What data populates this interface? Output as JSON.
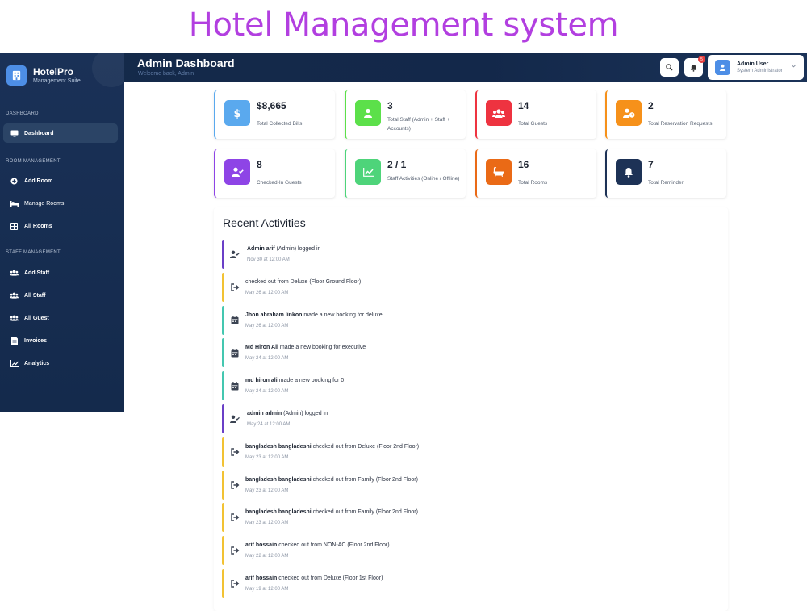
{
  "caption": "Hotel Management system",
  "brand": {
    "name": "HotelPro",
    "subtitle": "Management Suite"
  },
  "sidebar": {
    "sections": [
      {
        "title": "DASHBOARD",
        "items": [
          {
            "label": "Dashboard",
            "icon": "dashboard-icon",
            "active": true
          }
        ]
      },
      {
        "title": "ROOM MANAGEMENT",
        "items": [
          {
            "label": "Add Room",
            "icon": "plus-circle-icon"
          },
          {
            "label": "Manage Rooms",
            "icon": "bed-icon"
          },
          {
            "label": "All Rooms",
            "icon": "grid-icon"
          }
        ]
      },
      {
        "title": "STAFF MANAGEMENT",
        "items": [
          {
            "label": "Add Staff",
            "icon": "users-icon"
          },
          {
            "label": "All Staff",
            "icon": "users-icon"
          },
          {
            "label": "All Guest",
            "icon": "users-icon"
          },
          {
            "label": "Invoices",
            "icon": "document-icon"
          },
          {
            "label": "Analytics",
            "icon": "chart-line-icon"
          }
        ]
      }
    ]
  },
  "header": {
    "title": "Admin Dashboard",
    "subtitle": "Welcome back, Admin",
    "notification_count": "5",
    "user": {
      "name": "Admin User",
      "role": "System Administrator"
    }
  },
  "stats": [
    {
      "value": "$8,665",
      "label": "Total Collected Bills",
      "icon": "dollar-icon",
      "color": "#5aa9ee",
      "accent": "#5aa9ee"
    },
    {
      "value": "3",
      "label": "Total Staff (Admin + Staff + Accounts)",
      "icon": "user-icon",
      "color": "#5ce04a",
      "accent": "#5ce04a"
    },
    {
      "value": "14",
      "label": "Total Guests",
      "icon": "users-icon",
      "color": "#ee3340",
      "accent": "#ee3340"
    },
    {
      "value": "2",
      "label": "Total Reservation Requests",
      "icon": "user-clock-icon",
      "color": "#f6911a",
      "accent": "#f6911a"
    },
    {
      "value": "8",
      "label": "Checked-In Guests",
      "icon": "user-check-icon",
      "color": "#8e44e6",
      "accent": "#8e44e6"
    },
    {
      "value": "2 / 1",
      "label": "Staff Activities (Online / Offline)",
      "icon": "chart-line-icon",
      "color": "#4ed47a",
      "accent": "#4ed47a"
    },
    {
      "value": "16",
      "label": "Total Rooms",
      "icon": "bath-icon",
      "color": "#ea6a16",
      "accent": "#ea6a16"
    },
    {
      "value": "7",
      "label": "Total Reminder",
      "icon": "bell-icon",
      "color": "#1d3256",
      "accent": "#1d3256"
    }
  ],
  "activities": {
    "title": "Recent Activities",
    "items": [
      {
        "bold": "Admin arif",
        "text": " (Admin) logged in",
        "time": "Nov 30 at 12:00 AM",
        "icon": "user-check-icon",
        "color": "#6a3fc7"
      },
      {
        "bold": "",
        "text": "checked out from Deluxe (Floor Ground Floor)",
        "time": "May 26 at 12:00 AM",
        "icon": "sign-out-icon",
        "color": "#f2c233"
      },
      {
        "bold": "Jhon abraham linkon",
        "text": " made a new booking for deluxe",
        "time": "May 26 at 12:00 AM",
        "icon": "calendar-icon",
        "color": "#44c7b0"
      },
      {
        "bold": "Md Hiron Ali",
        "text": " made a new booking for executive",
        "time": "May 24 at 12:00 AM",
        "icon": "calendar-icon",
        "color": "#44c7b0"
      },
      {
        "bold": "md hiron ali",
        "text": " made a new booking for 0",
        "time": "May 24 at 12:00 AM",
        "icon": "calendar-icon",
        "color": "#44c7b0"
      },
      {
        "bold": "admin admin",
        "text": " (Admin) logged in",
        "time": "May 24 at 12:00 AM",
        "icon": "user-check-icon",
        "color": "#6a3fc7"
      },
      {
        "bold": "bangladesh bangladeshi",
        "text": " checked out from Deluxe (Floor 2nd Floor)",
        "time": "May 23 at 12:00 AM",
        "icon": "sign-out-icon",
        "color": "#f2c233"
      },
      {
        "bold": "bangladesh bangladeshi",
        "text": " checked out from Family (Floor 2nd Floor)",
        "time": "May 23 at 12:00 AM",
        "icon": "sign-out-icon",
        "color": "#f2c233"
      },
      {
        "bold": "bangladesh bangladeshi",
        "text": " checked out from Family (Floor 2nd Floor)",
        "time": "May 23 at 12:00 AM",
        "icon": "sign-out-icon",
        "color": "#f2c233"
      },
      {
        "bold": "arif hossain",
        "text": " checked out from NON-AC (Floor 2nd Floor)",
        "time": "May 22 at 12:00 AM",
        "icon": "sign-out-icon",
        "color": "#f2c233"
      },
      {
        "bold": "arif hossain",
        "text": " checked out from Deluxe (Floor 1st Floor)",
        "time": "May 19 at 12:00 AM",
        "icon": "sign-out-icon",
        "color": "#f2c233"
      }
    ]
  }
}
